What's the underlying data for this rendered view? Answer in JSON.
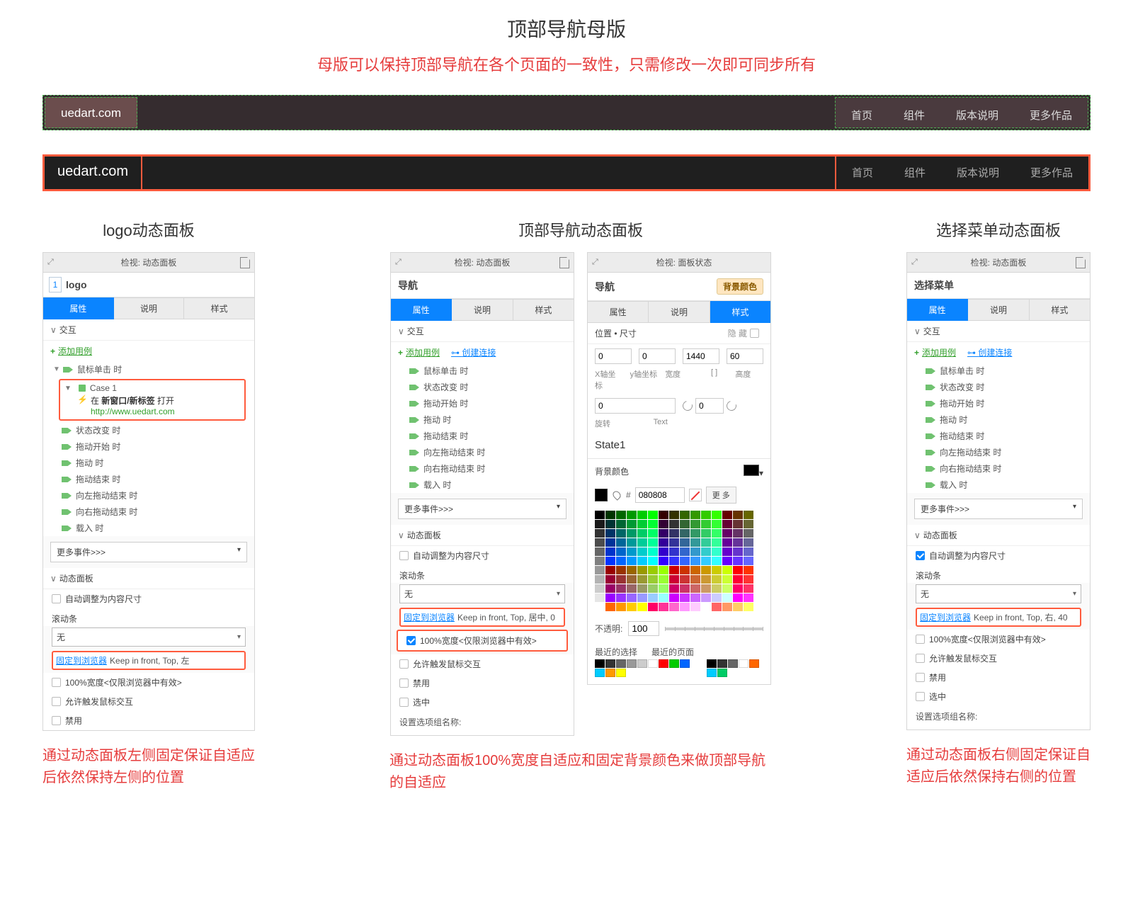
{
  "title": "顶部导航母版",
  "subtitle": "母版可以保持顶部导航在各个页面的一致性，只需修改一次即可同步所有",
  "nav": {
    "logo": "uedart.com",
    "items": [
      "首页",
      "组件",
      "版本说明",
      "更多作品"
    ]
  },
  "col_titles": {
    "left": "logo动态面板",
    "mid": "顶部导航动态面板",
    "right": "选择菜单动态面板"
  },
  "panel_header": "检视: 动态面板",
  "panel_header_state": "检视: 面板状态",
  "tabs": {
    "attr": "属性",
    "desc": "说明",
    "style": "样式"
  },
  "sections": {
    "interaction": "交互",
    "add_case": "添加用例",
    "create_link": "创建连接",
    "more_events": "更多事件>>>",
    "dyn_panel": "动态面板",
    "auto_size": "自动调整为内容尺寸",
    "scrollbar": "滚动条",
    "scroll_none": "无",
    "pin_link": "固定到浏览器",
    "full_width": "100%宽度<仅限浏览器中有效>",
    "allow_mouse": "允许触发鼠标交互",
    "disable": "禁用",
    "selected": "选中",
    "group_name": "设置选项组名称:"
  },
  "events": {
    "click": "鼠标单击 时",
    "state_change": "状态改变 时",
    "drag_start": "拖动开始 时",
    "drag": "拖动 时",
    "drag_end": "拖动结束 时",
    "drag_left_end": "向左拖动结束 时",
    "drag_right_end": "向右拖动结束 时",
    "load": "载入 时"
  },
  "left_panel": {
    "index": "1",
    "name": "logo",
    "case_title": "Case 1",
    "case_action_prefix": "在 ",
    "case_action_bold": "新窗口/新标签",
    "case_action_mid": " 打开 ",
    "case_action_url": "http://www.uedart.com",
    "pin_value": "Keep in front, Top, 左"
  },
  "mid_panel": {
    "name": "导航",
    "pin_value": "Keep in front, Top, 居中, 0"
  },
  "style_panel": {
    "name": "导航",
    "bg_btn": "背景颜色",
    "pos_size": "位置 • 尺寸",
    "hide": "隐 藏",
    "x": "0",
    "y": "0",
    "w": "1440",
    "h": "60",
    "xlab": "X轴坐标",
    "ylab": "y轴坐标",
    "wlab": "宽度",
    "hlab": "高度",
    "rot": "0",
    "rotlab": "旋转",
    "textlab": "Text",
    "state1": "State1",
    "bg_label": "背景颜色",
    "hex": "080808",
    "more": "更 多",
    "opacity_label": "不透明:",
    "opacity": "100",
    "recent_sel": "最近的选择",
    "recent_page": "最近的页面"
  },
  "right_panel": {
    "name": "选择菜单",
    "pin_value": "Keep in front, Top, 右, 40"
  },
  "footnotes": {
    "left": "通过动态面板左侧固定保证自适应后依然保持左侧的位置",
    "mid": "通过动态面板100%宽度自适应和固定背景颜色来做顶部导航的自适应",
    "right": "通过动态面板右侧固定保证自适应后依然保持右侧的位置"
  },
  "palette_colors": [
    "#000000",
    "#003300",
    "#006600",
    "#009900",
    "#00cc00",
    "#00ff00",
    "#330000",
    "#333300",
    "#336600",
    "#339900",
    "#33cc00",
    "#33ff00",
    "#660000",
    "#663300",
    "#666600",
    "#1a1a1a",
    "#003333",
    "#006633",
    "#009933",
    "#00cc33",
    "#00ff33",
    "#330033",
    "#333333",
    "#336633",
    "#339933",
    "#33cc33",
    "#33ff33",
    "#660033",
    "#663333",
    "#666633",
    "#333333",
    "#003366",
    "#006666",
    "#009966",
    "#00cc66",
    "#00ff66",
    "#330066",
    "#333366",
    "#336666",
    "#339966",
    "#33cc66",
    "#33ff66",
    "#660066",
    "#663366",
    "#666666",
    "#4d4d4d",
    "#003399",
    "#006699",
    "#009999",
    "#00cc99",
    "#00ff99",
    "#330099",
    "#333399",
    "#336699",
    "#339999",
    "#33cc99",
    "#33ff99",
    "#660099",
    "#663399",
    "#666699",
    "#666666",
    "#0033cc",
    "#0066cc",
    "#0099cc",
    "#00cccc",
    "#00ffcc",
    "#3300cc",
    "#3333cc",
    "#3366cc",
    "#3399cc",
    "#33cccc",
    "#33ffcc",
    "#6600cc",
    "#6633cc",
    "#6666cc",
    "#808080",
    "#0033ff",
    "#0066ff",
    "#0099ff",
    "#00ccff",
    "#00ffff",
    "#3300ff",
    "#3333ff",
    "#3366ff",
    "#3399ff",
    "#33ccff",
    "#33ffff",
    "#6600ff",
    "#6633ff",
    "#6666ff",
    "#999999",
    "#990000",
    "#993300",
    "#996600",
    "#999900",
    "#99cc00",
    "#99ff00",
    "#cc0000",
    "#cc3300",
    "#cc6600",
    "#cc9900",
    "#cccc00",
    "#ccff00",
    "#ff0000",
    "#ff3300",
    "#b3b3b3",
    "#990033",
    "#993333",
    "#996633",
    "#999933",
    "#99cc33",
    "#99ff33",
    "#cc0033",
    "#cc3333",
    "#cc6633",
    "#cc9933",
    "#cccc33",
    "#ccff33",
    "#ff0033",
    "#ff3333",
    "#cccccc",
    "#990066",
    "#993366",
    "#996666",
    "#999966",
    "#99cc66",
    "#99ff66",
    "#cc0066",
    "#cc3366",
    "#cc6666",
    "#cc9966",
    "#cccc66",
    "#ccff66",
    "#ff0066",
    "#ff3366",
    "#e6e6e6",
    "#9900ff",
    "#9933ff",
    "#9966ff",
    "#9999ff",
    "#99ccff",
    "#99ffff",
    "#cc00ff",
    "#cc33ff",
    "#cc66ff",
    "#cc99ff",
    "#ccccff",
    "#ccffff",
    "#ff00ff",
    "#ff33ff",
    "#ffffff",
    "#ff6600",
    "#ff9900",
    "#ffcc00",
    "#ffff00",
    "#ff0066",
    "#ff3399",
    "#ff66cc",
    "#ff99ff",
    "#ffccff",
    "#ffffff",
    "#ff6666",
    "#ff9966",
    "#ffcc66",
    "#ffff66"
  ],
  "recent_colors_left": [
    "#000000",
    "#333333",
    "#666666",
    "#999999",
    "#cccccc",
    "#ffffff",
    "#ff0000",
    "#00cc00",
    "#0066ff",
    "#00ccff",
    "#ff9900",
    "#ffff00"
  ],
  "recent_colors_right": [
    "#000000",
    "#333333",
    "#666666",
    "#ffffff",
    "#ff6600",
    "#00ccff",
    "#00cc66"
  ]
}
